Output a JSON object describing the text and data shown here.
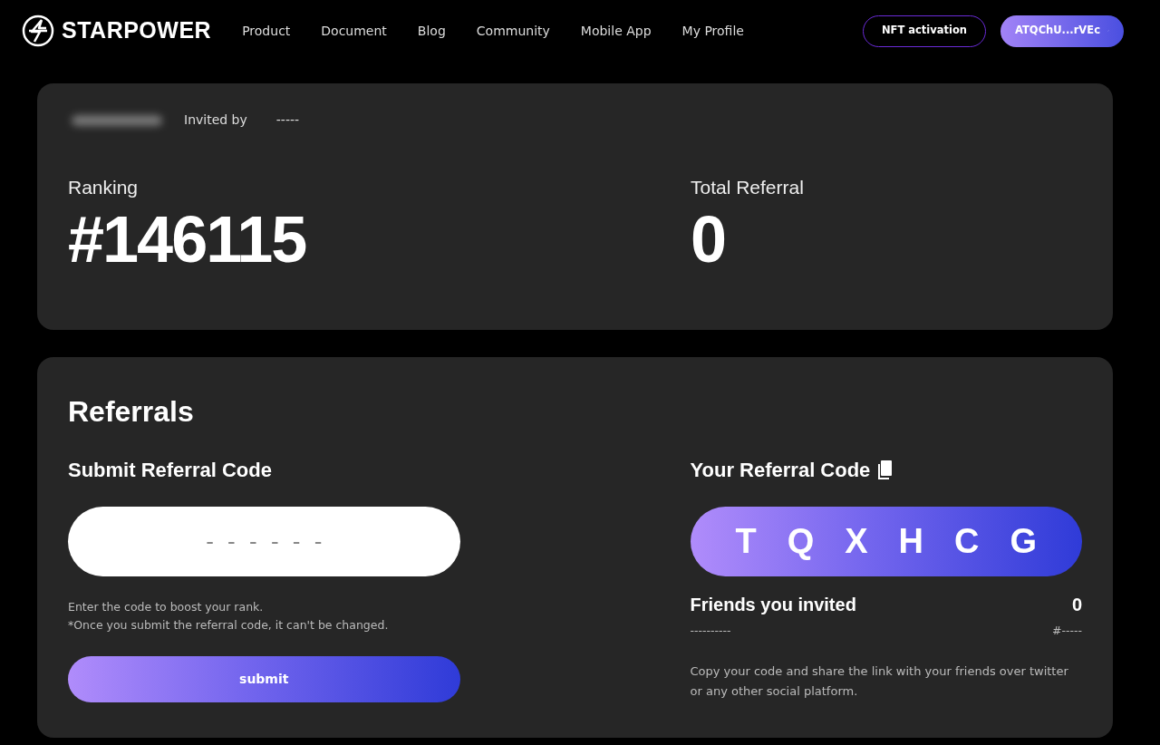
{
  "navbar": {
    "brand": "STARPOWER",
    "links": [
      "Product",
      "Document",
      "Blog",
      "Community",
      "Mobile App",
      "My Profile"
    ],
    "buttons": [
      {
        "kind": "outline",
        "label": "NFT activation"
      },
      {
        "kind": "wallet",
        "label": "ATQChU...rVEc"
      }
    ]
  },
  "summary": {
    "invited_by_label": "Invited by",
    "invited_by": "-----",
    "stats": [
      {
        "label": "Ranking",
        "value": "#146115"
      },
      {
        "label": "Total Referral",
        "value": "0"
      }
    ]
  },
  "referrals": {
    "title": "Referrals",
    "submit": {
      "title": "Submit Referral Code",
      "placeholder": "-  -  -  -  -  -",
      "hint_lines": [
        "Enter the code to boost your rank.",
        "*Once you submit the referral code, it can't be changed."
      ],
      "button": "submit"
    },
    "yours": {
      "title": "Your Referral Code",
      "code": [
        "T",
        "Q",
        "X",
        "H",
        "C",
        "G"
      ],
      "friends_label": "Friends you invited",
      "friends_count": "0",
      "friend_name": "----------",
      "friend_rank": "#-----",
      "note": "Copy your code and share the link with your friends over twitter or any other social platform."
    }
  }
}
